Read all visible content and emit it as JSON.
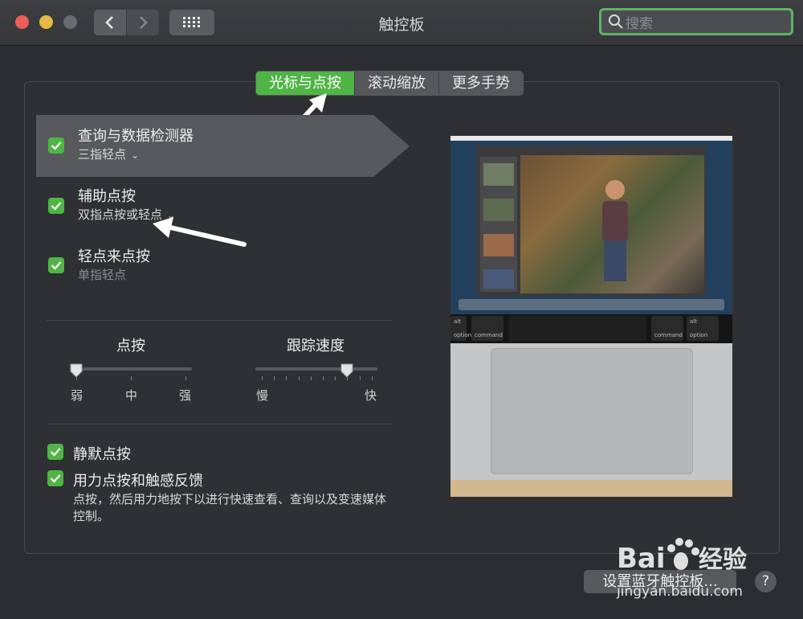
{
  "window": {
    "title": "触控板"
  },
  "search": {
    "placeholder": "搜索"
  },
  "tabs": [
    {
      "label": "光标与点按",
      "active": true
    },
    {
      "label": "滚动缩放",
      "active": false
    },
    {
      "label": "更多手势",
      "active": false
    }
  ],
  "options": [
    {
      "label": "查询与数据检测器",
      "sub": "三指轻点",
      "checked": true,
      "has_dropdown": true,
      "selected": true
    },
    {
      "label": "辅助点按",
      "sub": "双指点按或轻点",
      "checked": true,
      "has_dropdown": true
    },
    {
      "label": "轻点来点按",
      "sub": "单指轻点",
      "checked": true,
      "has_dropdown": false
    }
  ],
  "sliders": {
    "click": {
      "title": "点按",
      "labels": [
        "弱",
        "中",
        "强"
      ],
      "level": 0.0
    },
    "tracking": {
      "title": "跟踪速度",
      "labels": [
        "慢",
        "快"
      ],
      "level": 0.75
    }
  },
  "lower_options": [
    {
      "label": "静默点按",
      "checked": true
    },
    {
      "label": "用力点按和触感反馈",
      "checked": true,
      "desc": "点按，然后用力地按下以进行快速查看、查询以及变速媒体控制。"
    }
  ],
  "preview": {
    "touchbar_keys": [
      "option",
      "command",
      "command",
      "option"
    ],
    "modifier_label": "alt"
  },
  "bluetooth_button": "设置蓝牙触控板...",
  "help_label": "?",
  "watermark": {
    "brand": "Bai 经验",
    "url": "jingyan.baidu.com"
  },
  "colors": {
    "accent": "#4fb545",
    "background": "#2b2d30"
  }
}
